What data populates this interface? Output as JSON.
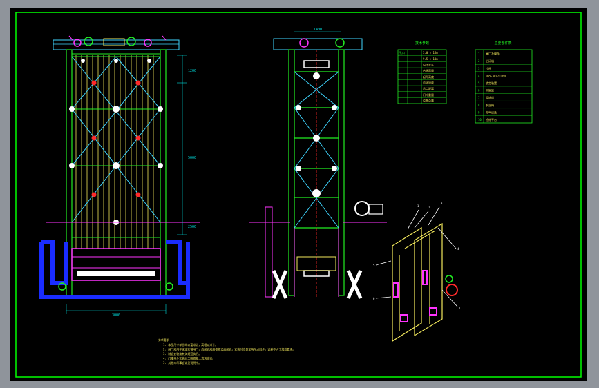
{
  "drawing": {
    "background": "#000000",
    "frame_color": "#00ff00",
    "colors": {
      "structure_green": "#22ee22",
      "cable_yellow": "#f2e85c",
      "brace_cyan": "#3fd6ff",
      "node_white": "#ffffff",
      "node_red": "#ff2a2a",
      "machinery_magenta": "#ff33ff",
      "foundation_blue": "#1a2cff",
      "dimension_cyan": "#00e0e0"
    }
  },
  "elevation_front": {
    "dim_bottom": "3000",
    "dim_right_top": "1200",
    "dim_right_mid": "5000",
    "dim_right_low": "2500"
  },
  "elevation_side": {
    "dim_top": "1400"
  },
  "table_left": {
    "title": "技术参数",
    "rows": [
      [
        "孔口",
        "3.0 × 15m"
      ],
      [
        "",
        "9.5 × 10m"
      ],
      [
        "",
        "设计水头"
      ],
      [
        "",
        "启闭容量"
      ],
      [
        "",
        "起升高度"
      ],
      [
        "",
        "启闭速度"
      ],
      [
        "",
        "吊点距离"
      ],
      [
        "",
        "门叶重量"
      ],
      [
        "",
        "设备总重"
      ]
    ]
  },
  "table_right": {
    "title": "主要部件表",
    "rows": [
      [
        "1",
        "闸门及埋件"
      ],
      [
        "2",
        "启闭机"
      ],
      [
        "3",
        "拉杆"
      ],
      [
        "4",
        "QBS-50/2×160"
      ],
      [
        "5",
        "锁定装置"
      ],
      [
        "6",
        "平衡梁"
      ],
      [
        "7",
        "滑轮组"
      ],
      [
        "8",
        "钢丝绳"
      ],
      [
        "9",
        "电气设备"
      ],
      [
        "10",
        "检修平台"
      ]
    ]
  },
  "notes": {
    "title": "技术要求",
    "lines": [
      "1. 本图尺寸单位均以毫米计，高程以米计。",
      "2. 闸门采用平面定轮钢闸门，启闭机采用卷扬式启闭机，安装时应保证两吊点同步，误差不大于规范要求。",
      "3. 制造安装按有关规范执行。",
      "4. 门槽埋件安装后二期混凝土浇筑密实。",
      "5. 其他未尽事宜详见说明书。"
    ]
  },
  "detail": {
    "leaders": [
      "1",
      "2",
      "3",
      "4",
      "5",
      "6",
      "7"
    ]
  }
}
